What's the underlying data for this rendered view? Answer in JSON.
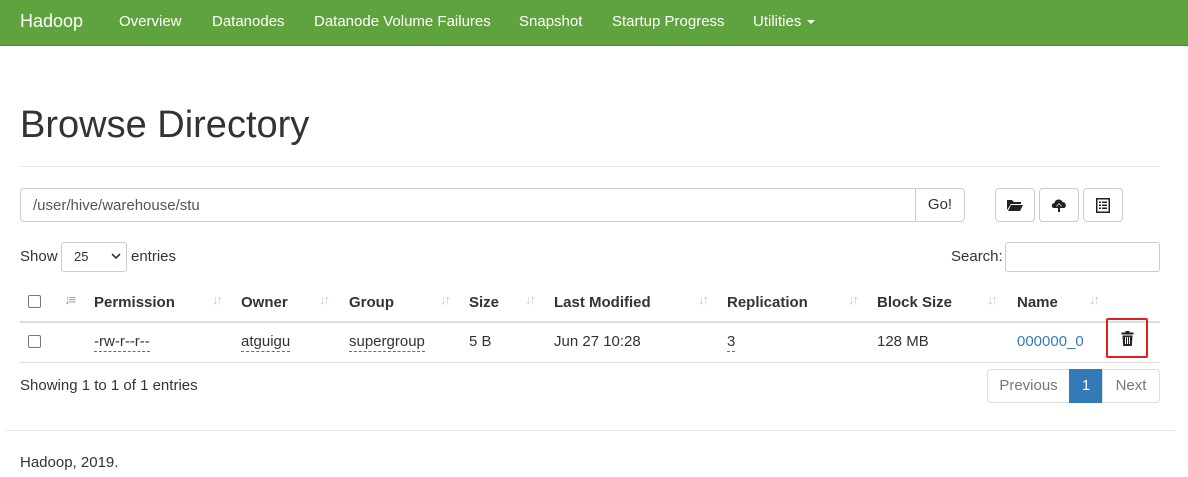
{
  "navbar": {
    "brand": "Hadoop",
    "items": [
      "Overview",
      "Datanodes",
      "Datanode Volume Failures",
      "Snapshot",
      "Startup Progress",
      "Utilities"
    ]
  },
  "page": {
    "title": "Browse Directory"
  },
  "path": {
    "value": "/user/hive/warehouse/stu",
    "go_label": "Go!"
  },
  "toolbar_icons": [
    "folder-open-icon",
    "cloud-upload-icon",
    "list-alt-icon"
  ],
  "entries": {
    "show_label": "Show",
    "selected": "25",
    "entries_label": "entries",
    "search_label": "Search:"
  },
  "table": {
    "columns": [
      "Permission",
      "Owner",
      "Group",
      "Size",
      "Last Modified",
      "Replication",
      "Block Size",
      "Name"
    ],
    "rows": [
      {
        "permission": "-rw-r--r--",
        "owner": "atguigu",
        "group": "supergroup",
        "size": "5 B",
        "last_modified": "Jun 27 10:28",
        "replication": "3",
        "block_size": "128 MB",
        "name": "000000_0"
      }
    ]
  },
  "info": "Showing 1 to 1 of 1 entries",
  "pagination": {
    "previous": "Previous",
    "current": "1",
    "next": "Next"
  },
  "footer": "Hadoop, 2019.",
  "colors": {
    "navbar": "#5fa33e",
    "link": "#337ab7",
    "highlight": "#e0201c"
  }
}
